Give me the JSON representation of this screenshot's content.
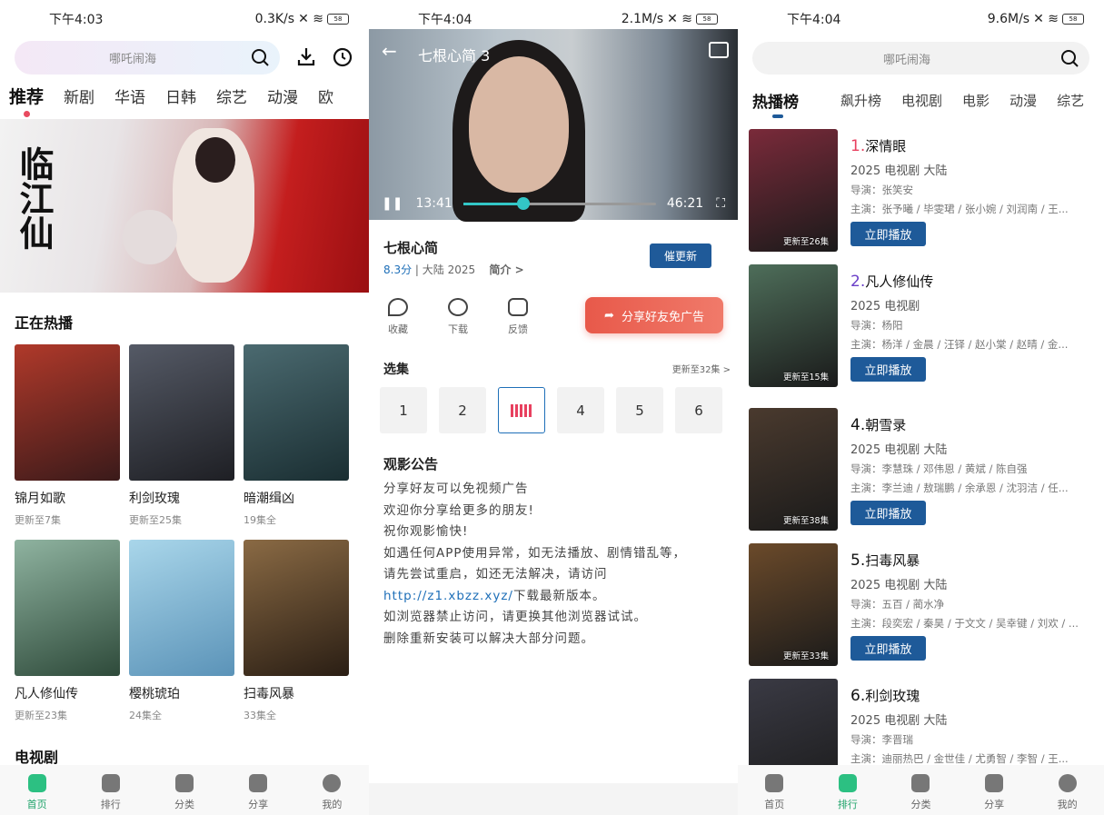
{
  "screen1": {
    "status": {
      "time": "下午4:03",
      "speed": "0.3K/s",
      "battery": "58"
    },
    "search_placeholder": "哪吒闹海",
    "tabs": [
      "推荐",
      "新剧",
      "华语",
      "日韩",
      "综艺",
      "动漫",
      "欧"
    ],
    "banner_title": "临江仙",
    "section1": "正在热播",
    "cards": [
      {
        "name": "锦月如歌",
        "sub": "更新至7集",
        "color": "#7a2e2e"
      },
      {
        "name": "利剑玫瑰",
        "sub": "更新至25集",
        "color": "#3a3a44"
      },
      {
        "name": "暗潮缉凶",
        "sub": "19集全",
        "color": "#2b4a4e"
      },
      {
        "name": "凡人修仙传",
        "sub": "更新至23集",
        "color": "#4e6e5a"
      },
      {
        "name": "樱桃琥珀",
        "sub": "24集全",
        "color": "#6aa7c8"
      },
      {
        "name": "扫毒风暴",
        "sub": "33集全",
        "color": "#6b4a2a"
      }
    ],
    "section2": "电视剧",
    "nav": [
      "首页",
      "排行",
      "分类",
      "分享",
      "我的"
    ]
  },
  "screen2": {
    "status": {
      "time": "下午4:04",
      "speed": "2.1M/s",
      "battery": "58"
    },
    "video_title": "七根心简 3",
    "time_current": "13:41",
    "time_total": "46:21",
    "progress": 0.31,
    "title": "七根心简",
    "score": "8.3分",
    "region": "大陆",
    "year": "2025",
    "intro": "简介 >",
    "urge_btn": "催更新",
    "actions": [
      "收藏",
      "下载",
      "反馈"
    ],
    "share_btn": "分享好友免广告",
    "episodes_title": "选集",
    "episodes_more": "更新至32集 >",
    "episodes": [
      "1",
      "2",
      "",
      "4",
      "5",
      "6"
    ],
    "notice_title": "观影公告",
    "notice_lines": [
      "分享好友可以免视频广告",
      "欢迎你分享给更多的朋友!",
      "祝你观影愉快!",
      "如遇任何APP使用异常，如无法播放、剧情错乱等，",
      "请先尝试重启，如还无法解决，请访问",
      "下载最新版本。",
      "如浏览器禁止访问，请更换其他浏览器试试。",
      "删除重新安装可以解决大部分问题。"
    ],
    "notice_link": "http://z1.xbzz.xyz/"
  },
  "screen3": {
    "status": {
      "time": "下午4:04",
      "speed": "9.6M/s",
      "battery": "58"
    },
    "search_placeholder": "哪吒闹海",
    "tabs": [
      "热播榜",
      "飙升榜",
      "电视剧",
      "电影",
      "动漫",
      "综艺"
    ],
    "play_label": "立即播放",
    "ranks": [
      {
        "num": "1.",
        "name": "深情眼",
        "info": "2025 电视剧 大陆",
        "director": "导演：张笑安",
        "cast": "主演：张予曦 / 毕雯珺 / 张小婉 / 刘润南 / 王...",
        "update": "更新至26集",
        "color": "#7a2a3a",
        "numcolor": "#e8405f"
      },
      {
        "num": "2.",
        "name": "凡人修仙传",
        "info": "2025 电视剧",
        "director": "导演：杨阳",
        "cast": "主演：杨洋 / 金晨 / 汪铎 / 赵小棠 / 赵晴 / 金...",
        "update": "更新至15集",
        "color": "#4e6e5a",
        "numcolor": "#6a3ec8"
      },
      {
        "num": "4.",
        "name": "朝雪录",
        "info": "2025 电视剧 大陆",
        "director": "导演：李慧珠 / 邓伟恩 / 黄斌 / 陈自强",
        "cast": "主演：李兰迪 / 敖瑞鹏 / 余承恩 / 沈羽洁 / 任...",
        "update": "更新至38集",
        "color": "#4a3a2e",
        "numcolor": "#111"
      },
      {
        "num": "5.",
        "name": "扫毒风暴",
        "info": "2025 电视剧 大陆",
        "director": "导演：五百 / 蔺水净",
        "cast": "主演：段奕宏 / 秦昊 / 于文文 / 吴幸键 / 刘欢 / ...",
        "update": "更新至33集",
        "color": "#6b4a2a",
        "numcolor": "#111"
      },
      {
        "num": "6.",
        "name": "利剑玫瑰",
        "info": "2025 电视剧 大陆",
        "director": "导演：李晋瑞",
        "cast": "主演：迪丽热巴 / 金世佳 / 尤勇智 / 李智 / 王...",
        "update": "",
        "color": "#3a3a44",
        "numcolor": "#111"
      }
    ],
    "nav": [
      "首页",
      "排行",
      "分类",
      "分享",
      "我的"
    ]
  }
}
